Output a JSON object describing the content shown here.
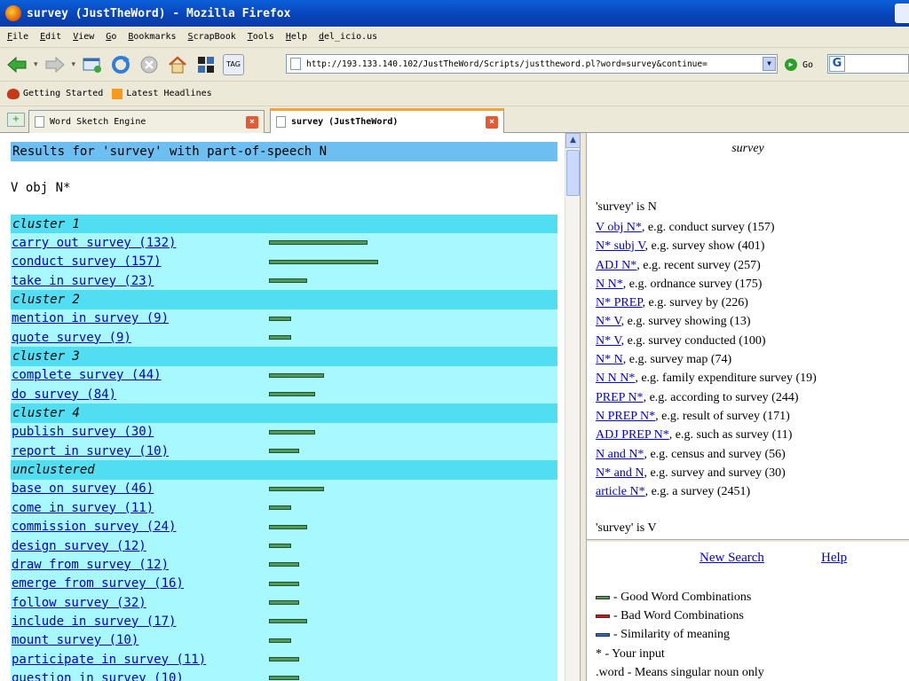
{
  "window": {
    "title": "survey (JustTheWord) - Mozilla Firefox"
  },
  "menu": [
    "File",
    "Edit",
    "View",
    "Go",
    "Bookmarks",
    "ScrapBook",
    "Tools",
    "Help",
    "del_icio.us"
  ],
  "nav": {
    "url": "http://193.133.140.102/JustTheWord/Scripts/justtheword.pl?word=survey&continue=",
    "go_label": "Go",
    "tag_label": "TAG"
  },
  "bookmarks": [
    "Getting Started",
    "Latest Headlines"
  ],
  "tabs": [
    {
      "label": "Word Sketch Engine",
      "active": false
    },
    {
      "label": "survey (JustTheWord)",
      "active": true
    }
  ],
  "left": {
    "results_header": "Results for 'survey' with part-of-speech N",
    "pattern": "V obj N*",
    "rows": [
      {
        "kind": "head",
        "label": "cluster 1"
      },
      {
        "kind": "item",
        "label": "carry out survey (132)",
        "bar": 0.18
      },
      {
        "kind": "item",
        "label": "conduct survey (157)",
        "bar": 0.2
      },
      {
        "kind": "item",
        "label": "take in survey (23)",
        "bar": 0.07
      },
      {
        "kind": "head",
        "label": "cluster 2"
      },
      {
        "kind": "item",
        "label": "mention in survey (9)",
        "bar": 0.04
      },
      {
        "kind": "item",
        "label": "quote survey (9)",
        "bar": 0.04
      },
      {
        "kind": "head",
        "label": "cluster 3"
      },
      {
        "kind": "item",
        "label": "complete survey (44)",
        "bar": 0.1
      },
      {
        "kind": "item",
        "label": "do survey (84)",
        "bar": 0.085
      },
      {
        "kind": "head",
        "label": "cluster 4"
      },
      {
        "kind": "item",
        "label": "publish survey (30)",
        "bar": 0.085
      },
      {
        "kind": "item",
        "label": "report in survey (10)",
        "bar": 0.055
      },
      {
        "kind": "head",
        "label": "unclustered"
      },
      {
        "kind": "item",
        "label": "base on survey (46)",
        "bar": 0.1
      },
      {
        "kind": "item",
        "label": "come in survey (11)",
        "bar": 0.04
      },
      {
        "kind": "item",
        "label": "commission survey (24)",
        "bar": 0.07
      },
      {
        "kind": "item",
        "label": "design survey (12)",
        "bar": 0.04
      },
      {
        "kind": "item",
        "label": "draw from survey (12)",
        "bar": 0.055
      },
      {
        "kind": "item",
        "label": "emerge from survey (16)",
        "bar": 0.055
      },
      {
        "kind": "item",
        "label": "follow survey (32)",
        "bar": 0.055
      },
      {
        "kind": "item",
        "label": "include in survey (17)",
        "bar": 0.07
      },
      {
        "kind": "item",
        "label": "mount survey (10)",
        "bar": 0.04
      },
      {
        "kind": "item",
        "label": "participate in survey (11)",
        "bar": 0.055
      },
      {
        "kind": "item",
        "label": "question in survey (10)",
        "bar": 0.055
      }
    ]
  },
  "right": {
    "word": "survey",
    "n_heading": "'survey' is N",
    "relations": [
      {
        "link": "V obj N*",
        "example": ", e.g.  conduct survey (157)"
      },
      {
        "link": "N* subj V",
        "example": ", e.g.  survey show (401)"
      },
      {
        "link": "ADJ N*",
        "example": ", e.g.  recent survey (257)"
      },
      {
        "link": "N N*",
        "example": ", e.g.  ordnance survey (175)"
      },
      {
        "link": "N* PREP",
        "example": ", e.g.  survey by (226)"
      },
      {
        "link": "N* V",
        "example": ", e.g.  survey showing (13)"
      },
      {
        "link": "N* V",
        "example": ", e.g.  survey conducted (100)"
      },
      {
        "link": "N* N",
        "example": ", e.g.  survey map (74)"
      },
      {
        "link": "N N N*",
        "example": ", e.g.  family expenditure survey (19)"
      },
      {
        "link": "PREP N*",
        "example": ", e.g.  according to survey (244)"
      },
      {
        "link": "N PREP N*",
        "example": ", e.g.  result of survey (171)"
      },
      {
        "link": "ADJ PREP N*",
        "example": ", e.g.  such as survey (11)"
      },
      {
        "link": "N and N*",
        "example": ", e.g.  census and survey (56)"
      },
      {
        "link": "N* and N",
        "example": ", e.g.  survey and survey (30)"
      },
      {
        "link": "article N*",
        "example": ", e.g. a survey (2451)"
      }
    ],
    "v_heading": "'survey' is V",
    "new_search": "New Search",
    "help": "Help",
    "legend": [
      {
        "color": "#4d9a5a",
        "label": "- Good Word Combinations"
      },
      {
        "color": "#e01010",
        "label": "- Bad Word Combinations"
      },
      {
        "color": "#1f6fd0",
        "label": "- Similarity of meaning"
      },
      {
        "color": "",
        "label": "* - Your input"
      },
      {
        "color": "",
        "label": ".word - Means singular noun only"
      }
    ]
  }
}
